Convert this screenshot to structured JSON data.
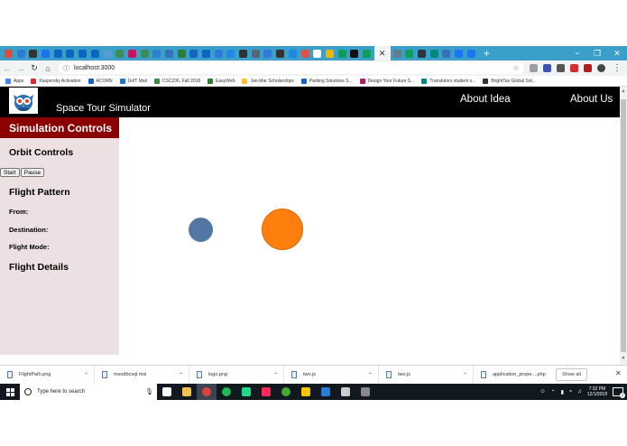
{
  "browser": {
    "address": "localhost:3000",
    "tab_colors": [
      "#e04b3a",
      "#2d7bd6",
      "#333333",
      "#1a73e8",
      "#0a66c2",
      "#0a66c2",
      "#0a66c2",
      "#0a66c2",
      "#5a9bd5",
      "#3c8d5b",
      "#c2185b",
      "#3c8d5b",
      "#2f7fd0",
      "#3a6fbe",
      "#2e7d32",
      "#1565c0",
      "#0a66c2",
      "#2d7bd6",
      "#1e88e5",
      "#333333",
      "#5a6570",
      "#2d7bd6",
      "#333333",
      "#1e88e5",
      "#d9534f",
      "#ffffff",
      "#f4b400",
      "#0f9d58",
      "#111111",
      "#0f9d58",
      "#607d8b",
      "#0f9d58",
      "#333333",
      "#00897b",
      "#3a6fbe",
      "#1877f2",
      "#1877f2"
    ],
    "new_tab_label": "+",
    "window": {
      "minimize": "−",
      "maximize": "❐",
      "close": "✕"
    }
  },
  "bookmarks": [
    {
      "label": "Apps",
      "color": "#4285f4"
    },
    {
      "label": "Kaspersky Activation",
      "color": "#d32f2f"
    },
    {
      "label": "ACORN",
      "color": "#1565c0"
    },
    {
      "label": "UofT Mail",
      "color": "#1976d2"
    },
    {
      "label": "CSC236, Fall 2018",
      "color": "#388e3c"
    },
    {
      "label": "EasyWeb",
      "color": "#2e7d32"
    },
    {
      "label": "Jan-Mar Scholarships",
      "color": "#fbc02d"
    },
    {
      "label": "Parking Solutions S...",
      "color": "#1565c0"
    },
    {
      "label": "Design Your Future S...",
      "color": "#c2185b"
    },
    {
      "label": "Transtutors student s...",
      "color": "#00897b"
    },
    {
      "label": "BrightTax Global Sol...",
      "color": "#333333"
    }
  ],
  "app": {
    "title": "Space Tour Simulator",
    "nav": {
      "about_idea": "About Idea",
      "about_us": "About Us"
    },
    "sidebar": {
      "header": "Simulation Controls",
      "orbit_controls": "Orbit Controls",
      "start_button": "Start",
      "pause_button": "Pause",
      "flight_pattern": "Flight Pattern",
      "from_label": "From:",
      "destination_label": "Destination:",
      "flight_mode_label": "Flight Mode:",
      "flight_details": "Flight Details"
    },
    "planets": [
      {
        "name": "small-planet",
        "color": "#5277a3"
      },
      {
        "name": "large-planet",
        "color": "#ff7f0e"
      }
    ]
  },
  "downloads": {
    "items": [
      "FlightPath.png",
      "msodbcsql.msi",
      "logo.png",
      "two.js",
      "two.js",
      "application_prope....php"
    ],
    "show_all": "Show all"
  },
  "taskbar": {
    "search_placeholder": "Type here to search",
    "time": "7:32 PM",
    "date": "12/1/2018",
    "notification_count": "2",
    "apps": [
      {
        "name": "task-view",
        "color": "#ffffff"
      },
      {
        "name": "file-explorer",
        "color": "#f2c14e"
      },
      {
        "name": "chrome",
        "color": "#db4437"
      },
      {
        "name": "spotify",
        "color": "#1db954"
      },
      {
        "name": "pycharm",
        "color": "#21d789"
      },
      {
        "name": "intellij",
        "color": "#fe2857"
      },
      {
        "name": "anaconda",
        "color": "#44a833"
      },
      {
        "name": "dev-tool",
        "color": "#f7c600"
      },
      {
        "name": "vscode",
        "color": "#2b7bd6"
      },
      {
        "name": "terminal",
        "color": "#cccccc"
      },
      {
        "name": "window-app",
        "color": "#888888"
      }
    ]
  }
}
